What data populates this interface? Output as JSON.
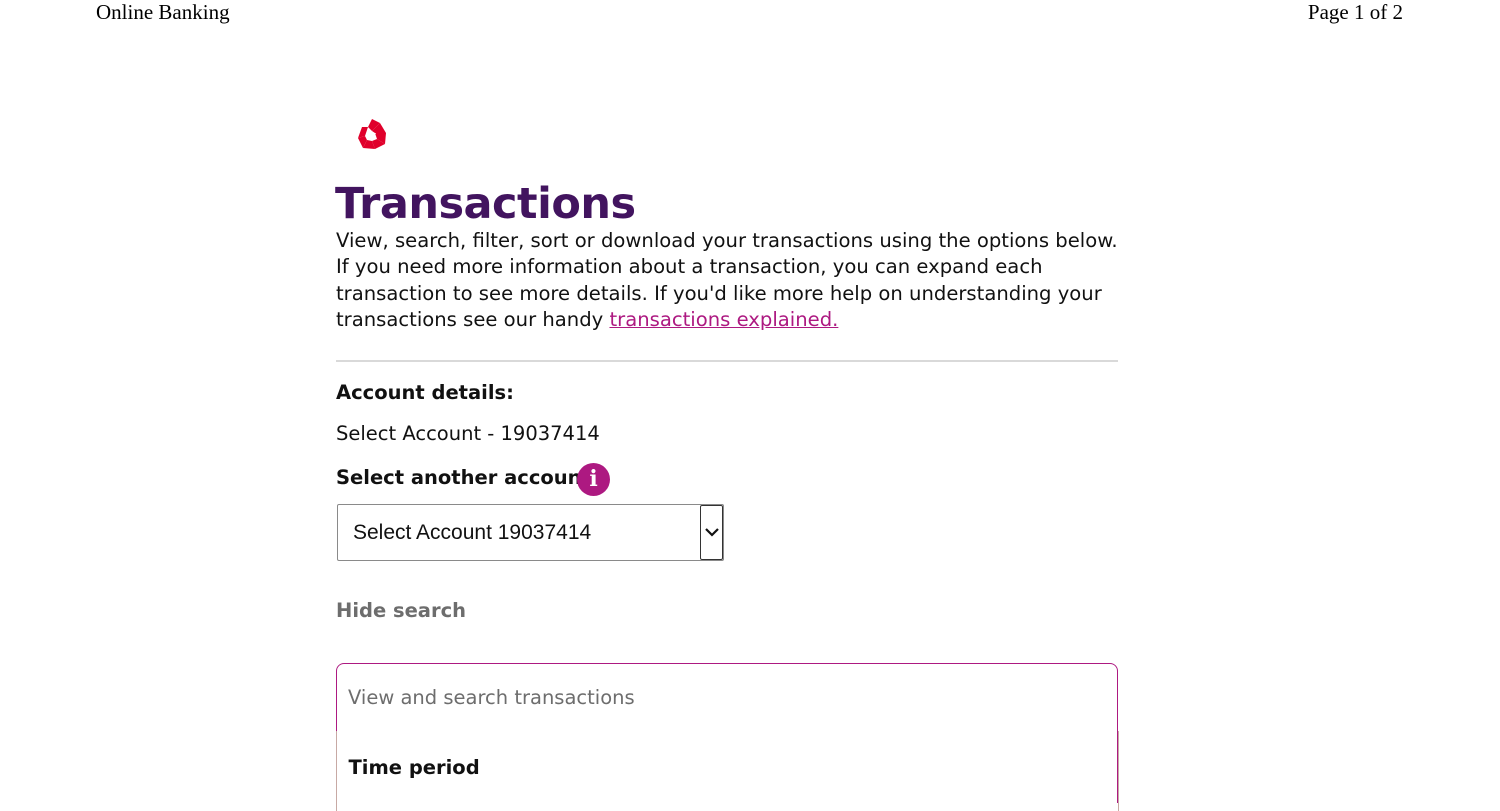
{
  "print_header": {
    "left": "Online Banking",
    "right": "Page 1 of 2"
  },
  "brand": {
    "logo_icon": "natwest-cube-logo-icon",
    "logo_color": "#e0002b",
    "primary_color": "#42145f",
    "accent_color": "#ad1981"
  },
  "page": {
    "title": "Transactions",
    "intro_text": "View, search, filter, sort or download your transactions using the options below. If you need more information about a transaction, you can expand each transaction to see more details. If you'd like more help on understanding your transactions see our handy ",
    "intro_link": "transactions explained."
  },
  "account": {
    "details_label": "Account details:",
    "details_value": "Select Account - 19037414",
    "select_another_label": "Select another account",
    "info_icon": "info-icon",
    "selected_option": "Select Account 19037414",
    "dropdown_icon": "chevron-down-icon"
  },
  "search": {
    "toggle_label": "Hide search",
    "panel_header": "View and search transactions",
    "time_period_label": "Time period"
  }
}
